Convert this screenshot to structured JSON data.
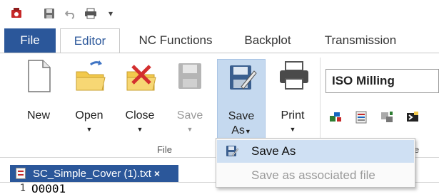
{
  "tabs": [
    "File",
    "Editor",
    "NC Functions",
    "Backplot",
    "Transmission"
  ],
  "ribbon": {
    "new_label": "New",
    "open_label": "Open",
    "close_label": "Close",
    "save_label": "Save",
    "saveas_label_1": "Save",
    "saveas_label_2": "As",
    "print_label": "Print",
    "group_file": "File",
    "group_trunc": "e",
    "machine_combo": "ISO Milling"
  },
  "dropdown": {
    "save_as": "Save As",
    "save_assoc": "Save as associated file"
  },
  "document": {
    "tab_title": "SC_Simple_Cover (1).txt",
    "close_glyph": "×",
    "line_number": "1",
    "line_text": "O0001"
  },
  "colors": {
    "accent": "#2b579a",
    "highlight": "#c5d9ef",
    "menu_hover": "#cfe0f3"
  }
}
